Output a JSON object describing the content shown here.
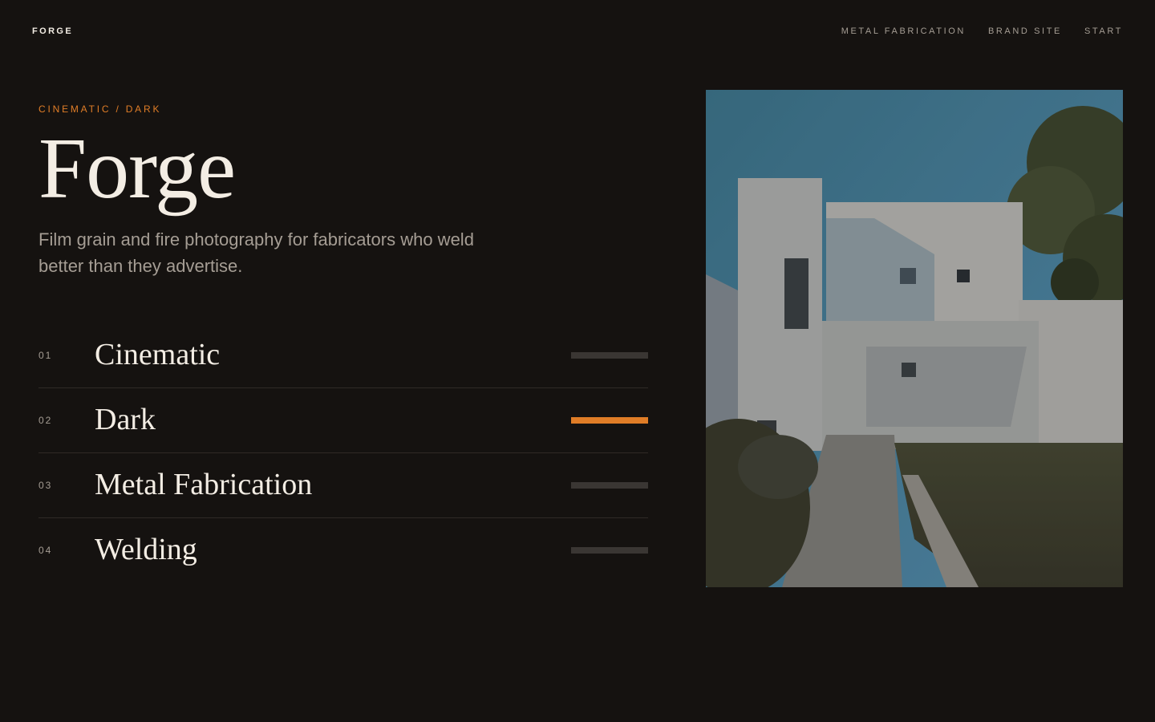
{
  "header": {
    "logo": "FORGE",
    "nav": [
      "METAL FABRICATION",
      "BRAND SITE",
      "START"
    ]
  },
  "hero": {
    "eyebrow": "CINEMATIC / DARK",
    "title": "Forge",
    "lede": "Film grain and fire photography for fabricators who weld better than they advertise."
  },
  "list": {
    "items": [
      {
        "num": "01",
        "label": "Cinematic",
        "active": false
      },
      {
        "num": "02",
        "label": "Dark",
        "active": true
      },
      {
        "num": "03",
        "label": "Metal Fabrication",
        "active": false
      },
      {
        "num": "04",
        "label": "Welding",
        "active": false
      }
    ]
  },
  "colors": {
    "background": "#151210",
    "accent": "#e07d27",
    "text": "#f3ede4",
    "muted": "#a59d94",
    "inactive_bar": "#3a3633"
  },
  "photo": {
    "subject": "photo-white-house"
  }
}
